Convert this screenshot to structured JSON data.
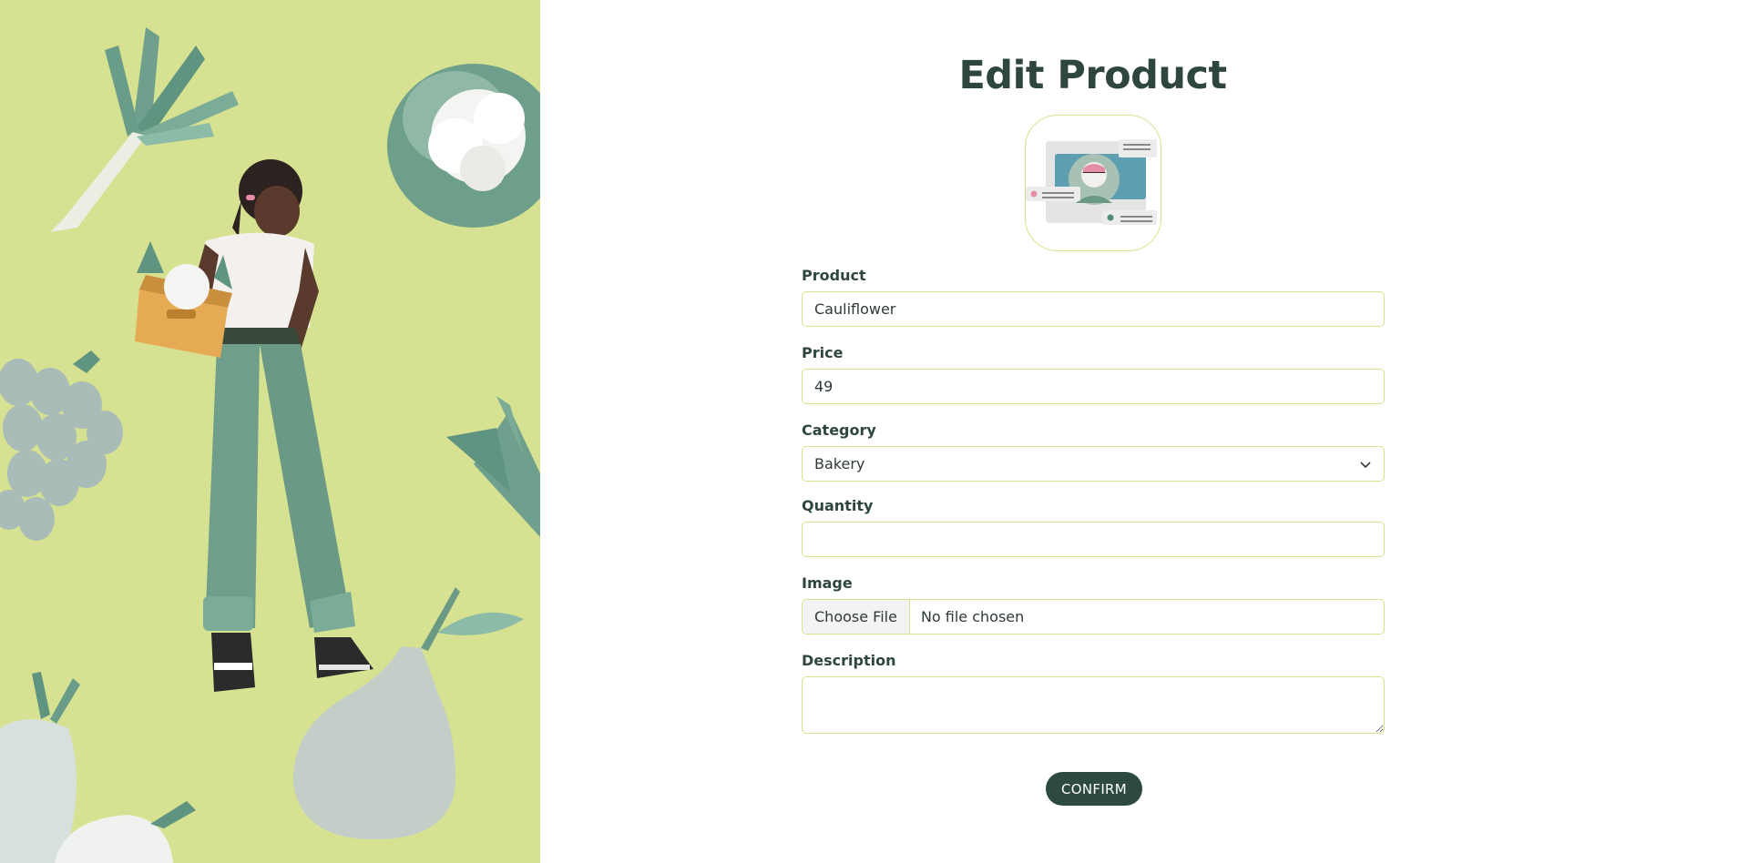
{
  "page": {
    "title": "Edit Product"
  },
  "form": {
    "product": {
      "label": "Product",
      "value": "Cauliflower"
    },
    "price": {
      "label": "Price",
      "value": "49"
    },
    "category": {
      "label": "Category",
      "selected": "Bakery"
    },
    "quantity": {
      "label": "Quantity",
      "value": ""
    },
    "image": {
      "label": "Image",
      "button": "Choose File",
      "status": "No file chosen"
    },
    "description": {
      "label": "Description",
      "value": ""
    },
    "confirm_label": "CONFIRM"
  },
  "colors": {
    "left_background": "#d6e292",
    "accent_border": "#d9e28c",
    "primary_button": "#2c4a3e",
    "title_text": "#2f4640"
  },
  "icons": {
    "category_dropdown": "chevron-down-icon",
    "profile_illustration": "profile-card-icon"
  }
}
